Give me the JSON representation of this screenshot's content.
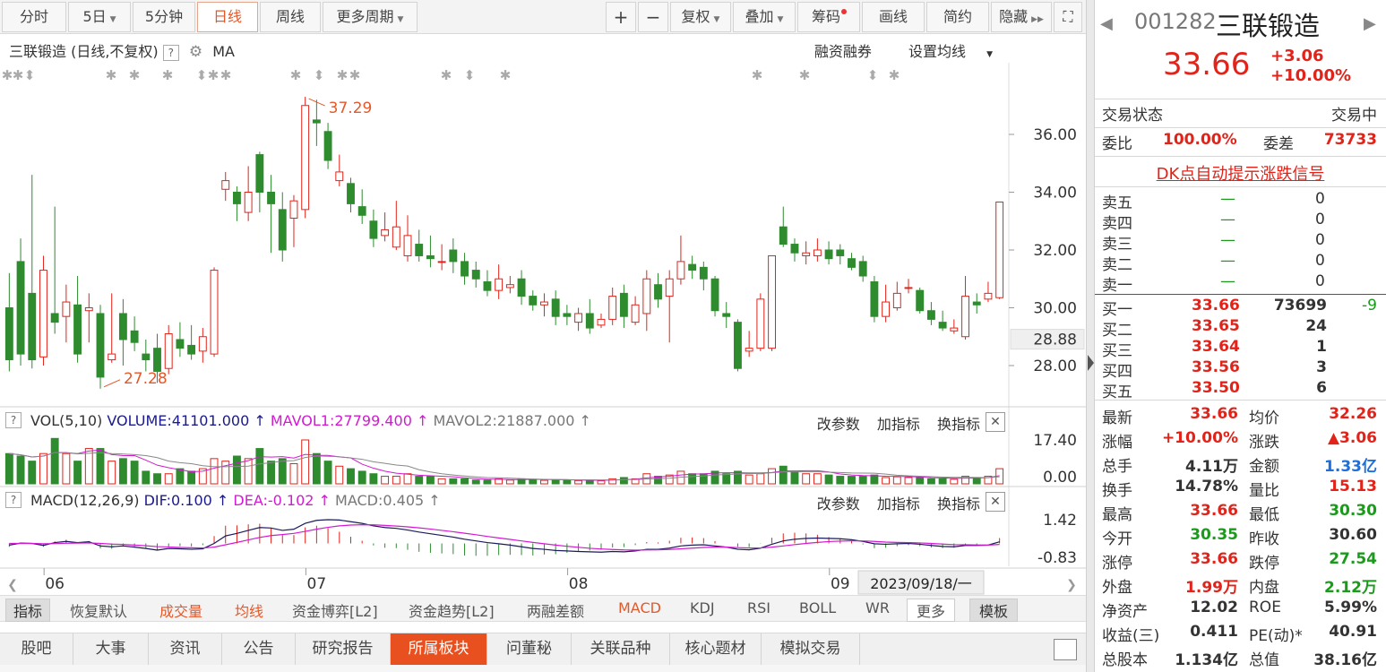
{
  "toolbar": {
    "periods": [
      "分时",
      "5日",
      "5分钟",
      "日线",
      "周线",
      "更多周期"
    ],
    "active_period": "日线",
    "tools": [
      "+",
      "−",
      "复权",
      "叠加",
      "筹码",
      "画线",
      "简约",
      "隐藏"
    ]
  },
  "chart": {
    "title": "三联锻造 (日线,不复权)",
    "indicator": "MA",
    "links": [
      "融资融券",
      "设置均线"
    ],
    "price_ticks": [
      "36.00",
      "34.00",
      "32.00",
      "30.00",
      "28.00"
    ],
    "current_price_label": "28.88",
    "high_annotation": "37.29",
    "low_annotation": "27.28"
  },
  "volume_panel": {
    "label_vol": "VOL(5,10)",
    "label_volume": "VOLUME:41101.000",
    "label_mavol1": "MAVOL1:27799.400",
    "label_mavol2": "MAVOL2:21887.000",
    "ticks": [
      "17.40",
      "0.00"
    ]
  },
  "macd_panel": {
    "label_macd": "MACD(12,26,9)",
    "label_dif": "DIF:0.100",
    "label_dea": "DEA:-0.102",
    "label_val": "MACD:0.405",
    "ticks": [
      "1.42",
      "-0.83"
    ]
  },
  "panel_buttons": [
    "改参数",
    "加指标",
    "换指标"
  ],
  "x_axis": {
    "months": [
      "06",
      "07",
      "08",
      "09"
    ],
    "date_box": "2023/09/18/一"
  },
  "indicator_tabs": [
    "指标",
    "恢复默认",
    "成交量",
    "均线",
    "资金博弈[L2]",
    "资金趋势[L2]",
    "两融差额",
    "MACD",
    "KDJ",
    "RSI",
    "BOLL",
    "WR",
    "更多",
    "模板"
  ],
  "bottom_tabs": [
    "股吧",
    "大事",
    "资讯",
    "公告",
    "研究报告",
    "所属板块",
    "问董秘",
    "关联品种",
    "核心题材",
    "模拟交易"
  ],
  "active_bottom_tab": "所属板块",
  "stock": {
    "code": "001282",
    "name": "三联锻造",
    "price": "33.66",
    "change": "+3.06",
    "change_pct": "+10.00%"
  },
  "status": {
    "label": "交易状态",
    "value": "交易中"
  },
  "committee": {
    "ratio_label": "委比",
    "ratio": "100.00%",
    "diff_label": "委差",
    "diff": "73733"
  },
  "signal_link": "DK点自动提示涨跌信号",
  "sell_orders": [
    {
      "label": "卖五",
      "price": "—",
      "vol": "0"
    },
    {
      "label": "卖四",
      "price": "—",
      "vol": "0"
    },
    {
      "label": "卖三",
      "price": "—",
      "vol": "0"
    },
    {
      "label": "卖二",
      "price": "—",
      "vol": "0"
    },
    {
      "label": "卖一",
      "price": "—",
      "vol": "0"
    }
  ],
  "buy_orders": [
    {
      "label": "买一",
      "price": "33.66",
      "vol": "73699",
      "chg": "-9"
    },
    {
      "label": "买二",
      "price": "33.65",
      "vol": "24",
      "chg": ""
    },
    {
      "label": "买三",
      "price": "33.64",
      "vol": "1",
      "chg": ""
    },
    {
      "label": "买四",
      "price": "33.56",
      "vol": "3",
      "chg": ""
    },
    {
      "label": "买五",
      "price": "33.50",
      "vol": "6",
      "chg": ""
    }
  ],
  "stats": [
    [
      "最新",
      "33.66",
      "均价",
      "32.26"
    ],
    [
      "涨幅",
      "+10.00%",
      "涨跌",
      "▲3.06"
    ],
    [
      "总手",
      "4.11万",
      "金额",
      "1.33亿"
    ],
    [
      "换手",
      "14.78%",
      "量比",
      "15.13"
    ],
    [
      "最高",
      "33.66",
      "最低",
      "30.30"
    ],
    [
      "今开",
      "30.35",
      "昨收",
      "30.60"
    ],
    [
      "涨停",
      "33.66",
      "跌停",
      "27.54"
    ],
    [
      "外盘",
      "1.99万",
      "内盘",
      "2.12万"
    ],
    [
      "净资产",
      "12.02",
      "ROE",
      "5.99%"
    ],
    [
      "收益(三)",
      "0.411",
      "PE(动)*",
      "40.91"
    ],
    [
      "总股本",
      "1.134亿",
      "总值",
      "38.16亿"
    ]
  ],
  "candles": [
    [
      30.0,
      28.2,
      31.2,
      27.8
    ],
    [
      31.6,
      28.4,
      32.4,
      28.0
    ],
    [
      30.5,
      28.2,
      34.6,
      27.9
    ],
    [
      28.3,
      31.3,
      31.8,
      28.0
    ],
    [
      29.8,
      29.5,
      33.5,
      29.1
    ],
    [
      29.7,
      30.2,
      30.8,
      28.8
    ],
    [
      30.1,
      28.4,
      31.1,
      28.1
    ],
    [
      29.9,
      30.0,
      30.5,
      28.8
    ],
    [
      29.8,
      27.6,
      30.1,
      27.2
    ],
    [
      28.2,
      28.4,
      30.5,
      28.1
    ],
    [
      29.8,
      28.9,
      30.3,
      28.0
    ],
    [
      29.2,
      28.8,
      29.7,
      28.5
    ],
    [
      28.4,
      28.2,
      28.9,
      27.8
    ],
    [
      28.6,
      27.8,
      29.1,
      27.4
    ],
    [
      27.9,
      29.1,
      29.4,
      27.7
    ],
    [
      28.9,
      28.6,
      29.5,
      28.3
    ],
    [
      28.7,
      28.4,
      29.4,
      28.2
    ],
    [
      28.5,
      29.0,
      29.3,
      28.1
    ],
    [
      28.4,
      31.3,
      31.4,
      28.3
    ],
    [
      34.1,
      34.4,
      34.7,
      33.7
    ],
    [
      34.0,
      33.6,
      34.2,
      33.0
    ],
    [
      33.3,
      34.0,
      34.9,
      33.0
    ],
    [
      35.3,
      34.0,
      35.4,
      33.3
    ],
    [
      34.0,
      33.6,
      34.6,
      31.9
    ],
    [
      33.4,
      32.0,
      34.0,
      31.6
    ],
    [
      33.1,
      33.7,
      33.9,
      32.1
    ],
    [
      33.4,
      37.0,
      37.3,
      33.1
    ],
    [
      36.5,
      36.4,
      37.2,
      35.6
    ],
    [
      36.1,
      35.1,
      36.4,
      34.8
    ],
    [
      34.4,
      34.7,
      35.3,
      34.2
    ],
    [
      34.3,
      33.6,
      34.5,
      33.3
    ],
    [
      33.5,
      33.2,
      34.1,
      32.9
    ],
    [
      33.0,
      32.4,
      33.4,
      32.1
    ],
    [
      32.5,
      32.7,
      33.3,
      32.3
    ],
    [
      32.1,
      32.8,
      33.7,
      32.0
    ],
    [
      31.8,
      32.5,
      33.2,
      31.6
    ],
    [
      32.2,
      31.8,
      32.7,
      31.6
    ],
    [
      31.8,
      31.7,
      32.5,
      31.4
    ],
    [
      31.6,
      31.6,
      32.2,
      31.3
    ],
    [
      32.0,
      31.6,
      32.4,
      31.2
    ],
    [
      31.6,
      31.1,
      31.9,
      30.8
    ],
    [
      31.3,
      31.0,
      31.6,
      30.7
    ],
    [
      30.9,
      30.6,
      31.3,
      30.4
    ],
    [
      30.6,
      31.0,
      31.5,
      30.3
    ],
    [
      30.7,
      30.8,
      31.1,
      30.5
    ],
    [
      31.0,
      30.4,
      31.3,
      30.1
    ],
    [
      30.4,
      30.1,
      30.6,
      29.9
    ],
    [
      30.1,
      30.2,
      30.5,
      29.7
    ],
    [
      30.3,
      29.7,
      30.6,
      29.4
    ],
    [
      29.8,
      29.7,
      30.1,
      29.4
    ],
    [
      29.5,
      29.8,
      30.0,
      29.2
    ],
    [
      29.8,
      29.3,
      30.3,
      29.1
    ],
    [
      29.4,
      29.6,
      29.8,
      29.3
    ],
    [
      29.6,
      30.4,
      30.7,
      29.4
    ],
    [
      30.5,
      29.7,
      30.8,
      29.3
    ],
    [
      29.5,
      30.1,
      30.4,
      29.4
    ],
    [
      29.8,
      31.0,
      31.3,
      29.2
    ],
    [
      30.8,
      30.3,
      31.2,
      30.0
    ],
    [
      30.4,
      31.0,
      31.3,
      28.8
    ],
    [
      31.0,
      31.6,
      32.5,
      30.8
    ],
    [
      31.5,
      31.3,
      31.8,
      31.0
    ],
    [
      31.4,
      31.0,
      31.6,
      30.6
    ],
    [
      31.0,
      29.9,
      31.1,
      29.7
    ],
    [
      29.8,
      29.7,
      30.2,
      29.3
    ],
    [
      29.5,
      27.9,
      29.6,
      27.8
    ],
    [
      28.5,
      28.6,
      29.2,
      28.3
    ],
    [
      28.6,
      30.3,
      30.5,
      28.5
    ],
    [
      28.6,
      31.8,
      31.8,
      28.5
    ],
    [
      32.8,
      32.2,
      33.5,
      32.1
    ],
    [
      32.2,
      31.9,
      32.4,
      31.6
    ],
    [
      31.8,
      31.9,
      32.3,
      31.5
    ],
    [
      31.8,
      32.0,
      32.4,
      31.6
    ],
    [
      32.0,
      31.7,
      32.3,
      31.5
    ],
    [
      32.0,
      31.8,
      32.2,
      31.5
    ],
    [
      31.7,
      31.4,
      31.9,
      31.3
    ],
    [
      31.6,
      31.1,
      31.8,
      30.9
    ],
    [
      30.9,
      29.7,
      31.1,
      29.5
    ],
    [
      29.7,
      30.2,
      30.8,
      29.5
    ],
    [
      30.0,
      30.5,
      30.9,
      29.9
    ],
    [
      30.7,
      30.7,
      31.0,
      30.5
    ],
    [
      30.6,
      29.9,
      30.7,
      29.8
    ],
    [
      29.9,
      29.6,
      30.2,
      29.4
    ],
    [
      29.5,
      29.3,
      29.9,
      29.2
    ],
    [
      29.2,
      29.3,
      29.6,
      29.1
    ],
    [
      29.0,
      30.4,
      31.1,
      28.9
    ],
    [
      30.2,
      30.1,
      30.5,
      29.8
    ],
    [
      30.3,
      30.5,
      30.9,
      30.2
    ],
    [
      30.35,
      33.66,
      33.66,
      30.3
    ]
  ],
  "volumes": [
    12,
    11,
    9,
    12,
    18,
    12,
    9,
    14,
    14,
    9,
    10,
    9,
    5,
    4,
    4,
    6,
    5,
    6,
    10,
    9,
    11,
    10,
    14,
    9,
    10,
    8,
    17.4,
    12,
    9,
    7,
    6,
    5,
    4,
    3,
    3,
    4,
    3,
    3,
    2,
    2,
    2,
    1.5,
    1.5,
    2,
    1.5,
    2,
    1.8,
    1.4,
    1.6,
    1.4,
    1.3,
    1.5,
    1.2,
    2,
    2.5,
    2,
    4,
    3,
    3.5,
    5,
    4,
    4,
    5,
    4,
    5,
    3.5,
    4,
    6,
    7,
    5,
    4,
    4,
    3.5,
    3,
    3,
    3,
    3.5,
    2.5,
    2.8,
    2.5,
    2.5,
    2,
    2,
    1.8,
    3,
    2.5,
    3,
    6
  ],
  "macd": {
    "dif": [
      -0.1,
      0.02,
      0.0,
      -0.12,
      0.05,
      0.12,
      0.05,
      0.1,
      -0.15,
      -0.2,
      -0.15,
      -0.22,
      -0.3,
      -0.4,
      -0.3,
      -0.32,
      -0.35,
      -0.32,
      0.0,
      0.45,
      0.6,
      0.78,
      0.95,
      0.92,
      0.78,
      0.85,
      1.2,
      1.38,
      1.42,
      1.4,
      1.3,
      1.2,
      1.05,
      0.95,
      0.9,
      0.8,
      0.68,
      0.58,
      0.48,
      0.38,
      0.25,
      0.15,
      0.05,
      -0.02,
      -0.1,
      -0.2,
      -0.3,
      -0.35,
      -0.42,
      -0.45,
      -0.48,
      -0.5,
      -0.52,
      -0.48,
      -0.5,
      -0.45,
      -0.35,
      -0.35,
      -0.28,
      -0.15,
      -0.1,
      -0.08,
      -0.15,
      -0.22,
      -0.35,
      -0.38,
      -0.28,
      -0.05,
      0.15,
      0.25,
      0.3,
      0.32,
      0.3,
      0.28,
      0.22,
      0.12,
      -0.02,
      -0.05,
      -0.02,
      0.0,
      -0.05,
      -0.12,
      -0.18,
      -0.2,
      -0.12,
      -0.12,
      -0.1,
      0.1
    ],
    "dea": [
      0.0,
      0.0,
      0.0,
      -0.02,
      -0.01,
      0.01,
      0.02,
      0.03,
      0.0,
      -0.04,
      -0.06,
      -0.1,
      -0.14,
      -0.19,
      -0.21,
      -0.24,
      -0.26,
      -0.27,
      -0.22,
      -0.08,
      0.06,
      0.21,
      0.36,
      0.47,
      0.53,
      0.6,
      0.72,
      0.85,
      0.96,
      1.05,
      1.1,
      1.12,
      1.11,
      1.08,
      1.04,
      0.99,
      0.93,
      0.86,
      0.78,
      0.7,
      0.61,
      0.52,
      0.42,
      0.33,
      0.24,
      0.15,
      0.06,
      -0.02,
      -0.1,
      -0.17,
      -0.23,
      -0.29,
      -0.33,
      -0.36,
      -0.39,
      -0.4,
      -0.39,
      -0.38,
      -0.36,
      -0.32,
      -0.28,
      -0.24,
      -0.22,
      -0.22,
      -0.25,
      -0.27,
      -0.27,
      -0.22,
      -0.15,
      -0.07,
      0.0,
      0.06,
      0.11,
      0.14,
      0.15,
      0.15,
      0.12,
      0.08,
      0.06,
      0.05,
      0.03,
      0.0,
      -0.04,
      -0.07,
      -0.08,
      -0.09,
      -0.1,
      -0.06
    ]
  }
}
